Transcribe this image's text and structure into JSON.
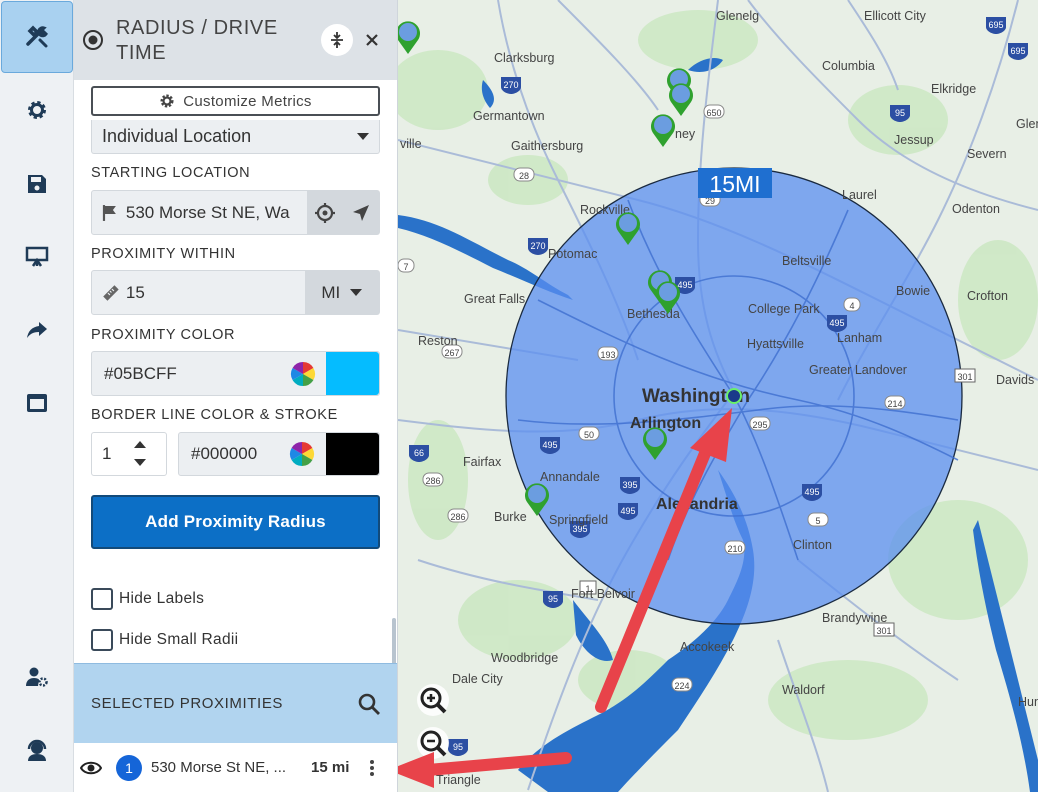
{
  "panel": {
    "title": "RADIUS / DRIVE TIME",
    "customize_label": "Customize Metrics",
    "location_type": "Individual Location",
    "starting_location": {
      "label": "STARTING LOCATION",
      "value": "530 Morse St NE, Wa"
    },
    "proximity": {
      "label": "PROXIMITY WITHIN",
      "value": "15",
      "unit": "MI"
    },
    "proximity_color": {
      "label": "PROXIMITY COLOR",
      "value": "#05BCFF",
      "swatch": "#05bcff"
    },
    "border": {
      "label": "BORDER LINE COLOR & STROKE",
      "stroke": "1",
      "color": "#000000",
      "swatch": "#000000"
    },
    "add_button": "Add Proximity Radius",
    "hide_labels": "Hide Labels",
    "hide_small_radii": "Hide Small Radii",
    "selected": {
      "title": "SELECTED PROXIMITIES",
      "items": [
        {
          "index": "1",
          "name": "530 Morse St NE, ...",
          "distance": "15 mi"
        }
      ]
    }
  },
  "rail": {
    "items": [
      "tools-icon",
      "gear-icon",
      "save-icon",
      "presentation-icon",
      "share-icon",
      "window-icon",
      "user-settings-icon",
      "support-icon"
    ]
  },
  "map": {
    "radius_label": "15MI",
    "circle_fill": "#5b8ff0",
    "places": {
      "glenelg": "Glenelg",
      "ellicott_city": "Ellicott City",
      "clarksburg": "Clarksburg",
      "columbia": "Columbia",
      "elkridge": "Elkridge",
      "germantown": "Germantown",
      "glen": "Glen",
      "jessup": "Jessup",
      "severn": "Severn",
      "ville": "ville",
      "gaithersburg": "Gaithersburg",
      "laurel": "Laurel",
      "odenton": "Odenton",
      "rockville": "Rockville",
      "beltsville": "Beltsville",
      "potomac": "Potomac",
      "bowie": "Bowie",
      "crofton": "Crofton",
      "great_falls": "Great Falls",
      "college_park": "College Park",
      "bethesda": "Bethesda",
      "reston": "Reston",
      "hyattsville": "Hyattsville",
      "lanham": "Lanham",
      "greater_landover": "Greater Landover",
      "davids": "Davids",
      "washington": "Washington",
      "arlington": "Arlington",
      "fairfax": "Fairfax",
      "annandale": "Annandale",
      "alexandria": "Alexandria",
      "burke": "Burke",
      "springfield": "Springfield",
      "clinton": "Clinton",
      "fort_belvoir": "Fort Belvoir",
      "brandywine": "Brandywine",
      "accokeek": "Accokeek",
      "woodbridge": "Woodbridge",
      "waldorf": "Waldorf",
      "dale_city": "Dale City",
      "hunt": "Hunt",
      "triangle": "Triangle",
      "ney": "ney"
    },
    "routes": [
      "695",
      "695",
      "270",
      "650",
      "95",
      "29",
      "28",
      "270",
      "495",
      "495",
      "193",
      "267",
      "66",
      "50",
      "495",
      "295",
      "214",
      "395",
      "395",
      "495",
      "286",
      "286",
      "495",
      "210",
      "5",
      "95",
      "301",
      "301",
      "4",
      "7",
      "1",
      "95",
      "224"
    ]
  }
}
